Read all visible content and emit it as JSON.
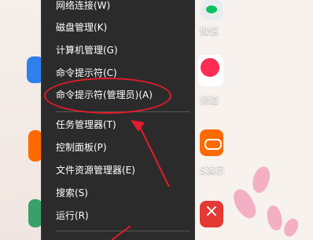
{
  "context_menu": {
    "items": [
      {
        "label": "网络连接(W)"
      },
      {
        "label": "磁盘管理(K)"
      },
      {
        "label": "计算机管理(G)"
      },
      {
        "label": "命令提示符(C)"
      },
      {
        "label": "命令提示符(管理员)(A)"
      },
      {
        "label": "任务管理器(T)"
      },
      {
        "label": "控制面板(P)"
      },
      {
        "label": "文件资源管理器(E)"
      },
      {
        "label": "搜索(S)"
      },
      {
        "label": "运行(R)"
      }
    ]
  },
  "desktop_icons": {
    "right_top_label": "微信",
    "right_mid_label": "频道",
    "right_lower_label": "S演示"
  },
  "colors": {
    "menu_bg": "#2b2b2b",
    "highlight_red": "#e31b2a",
    "pink": "#f2a7bf"
  }
}
